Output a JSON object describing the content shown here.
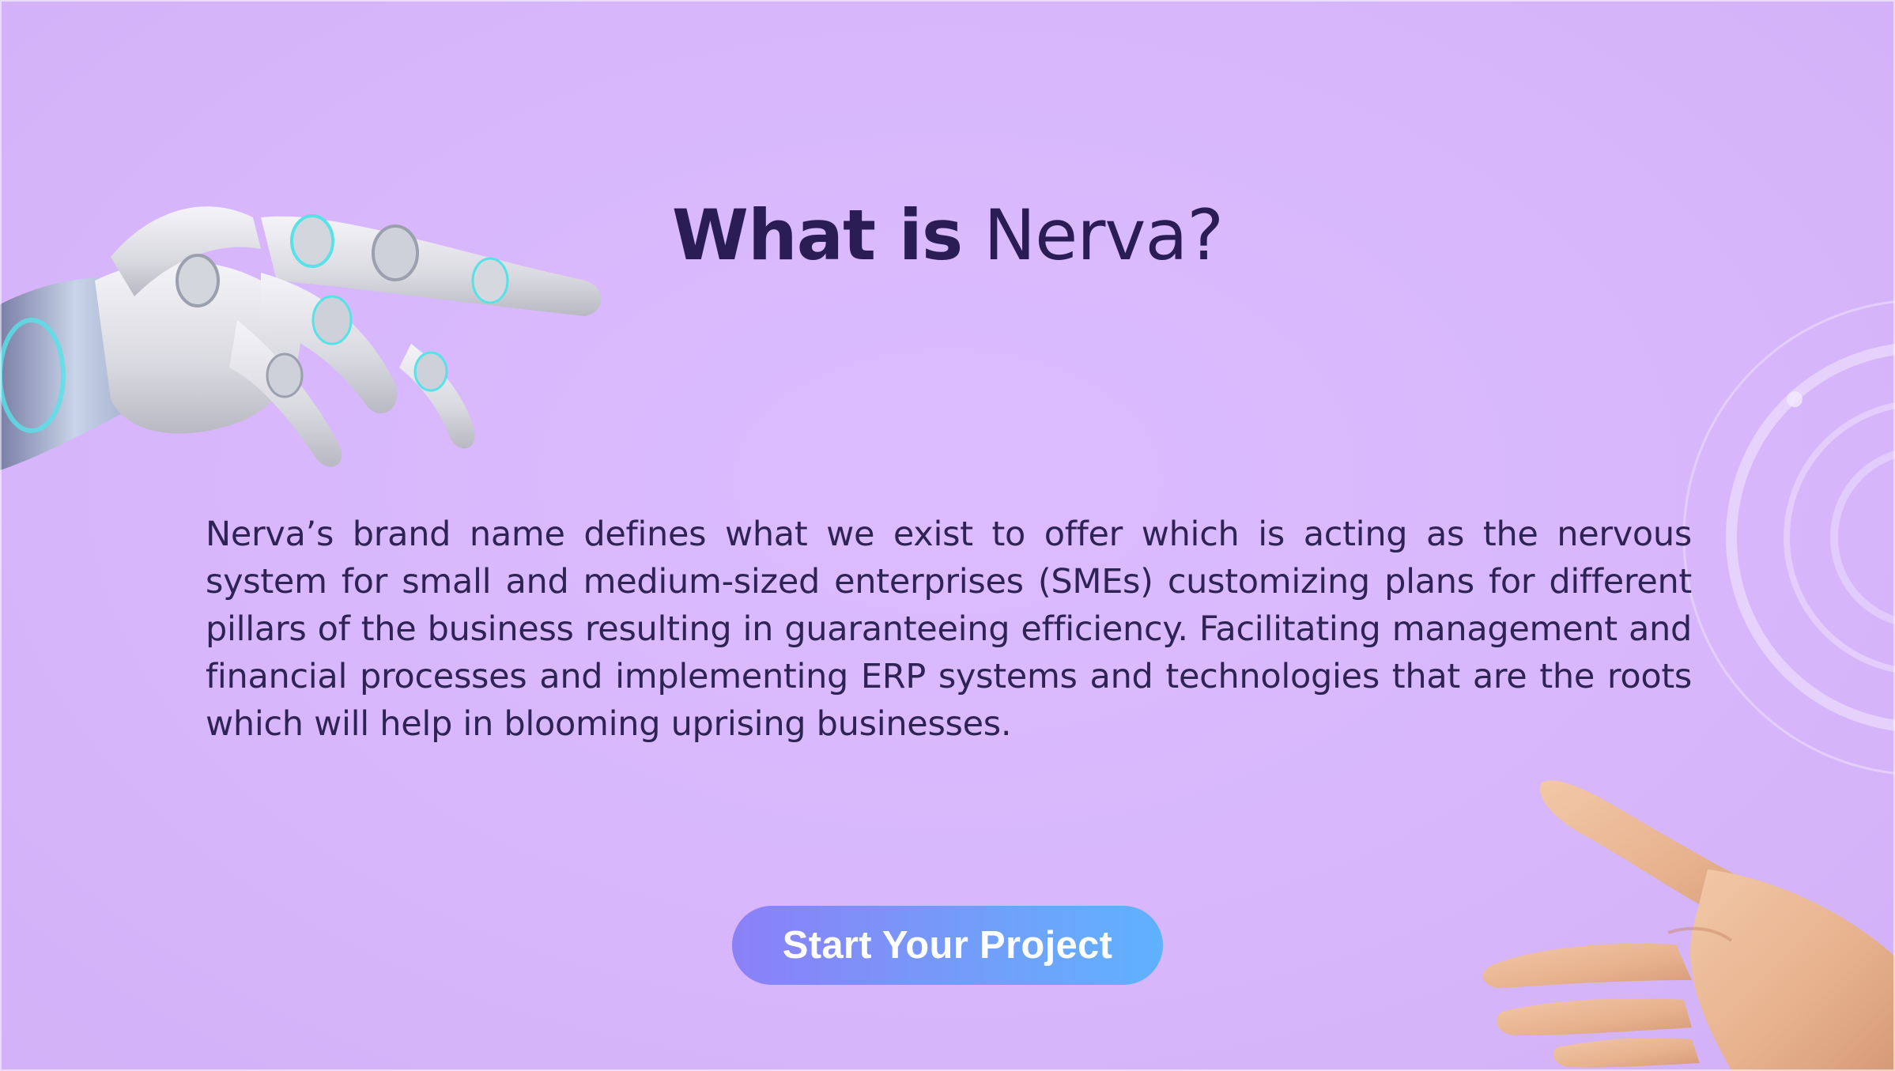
{
  "hero": {
    "title_bold": "What is",
    "title_light": "Nerva?",
    "description": "Nerva’s brand name defines what we exist to offer which is acting as the nervous system for small and medium-sized enterprises (SMEs) customizing plans for different pillars of the business resulting in guaranteeing efficiency. Facilitating management and financial processes and implementing ERP systems and technologies that are the roots which will help in blooming uprising businesses.",
    "cta_label": "Start Your Project"
  },
  "images": {
    "left": "robot-hand-image",
    "right": "human-hand-image",
    "decor": "concentric-rings-decoration"
  },
  "colors": {
    "background": "#d9b8fd",
    "title": "#2a1d55",
    "text": "#2f2356",
    "cta_start": "#8b80f7",
    "cta_end": "#5fb2fd"
  }
}
